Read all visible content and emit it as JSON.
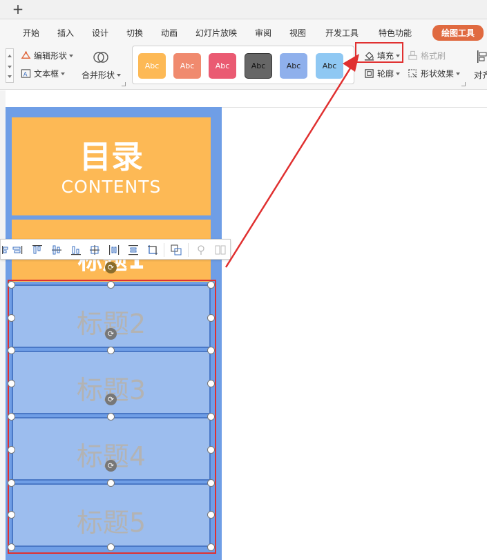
{
  "tabbar": {
    "new_tab": "+"
  },
  "menu": {
    "items": [
      "开始",
      "插入",
      "设计",
      "切换",
      "动画",
      "幻灯片放映",
      "审阅",
      "视图",
      "开发工具",
      "特色功能"
    ],
    "drawing_tools": "绘图工具"
  },
  "ribbon": {
    "edit_shape": "编辑形状",
    "text_box": "文本框",
    "merge_shape": "合并形状",
    "styles": [
      {
        "label": "Abc",
        "color": "#fdb955"
      },
      {
        "label": "Abc",
        "color": "#f08a6e"
      },
      {
        "label": "Abc",
        "color": "#ea5a72"
      },
      {
        "label": "Abc",
        "color": "#666666"
      },
      {
        "label": "Abc",
        "color": "#8fb0ec"
      },
      {
        "label": "Abc",
        "color": "#8fc8f3"
      }
    ],
    "fill": "填充",
    "format_painter": "格式刷",
    "outline": "轮廓",
    "shape_effects": "形状效果",
    "align": "对齐"
  },
  "slide": {
    "title": "目录",
    "subtitle": "CONTENTS",
    "item1": "标题1",
    "items": [
      "标题2",
      "标题3",
      "标题4",
      "标题5"
    ]
  },
  "colors": {
    "highlight": "#e03030",
    "accent_orange": "#fdb955",
    "accent_blue": "#9cbdee",
    "drawing_tools_tab": "#e06a40"
  }
}
